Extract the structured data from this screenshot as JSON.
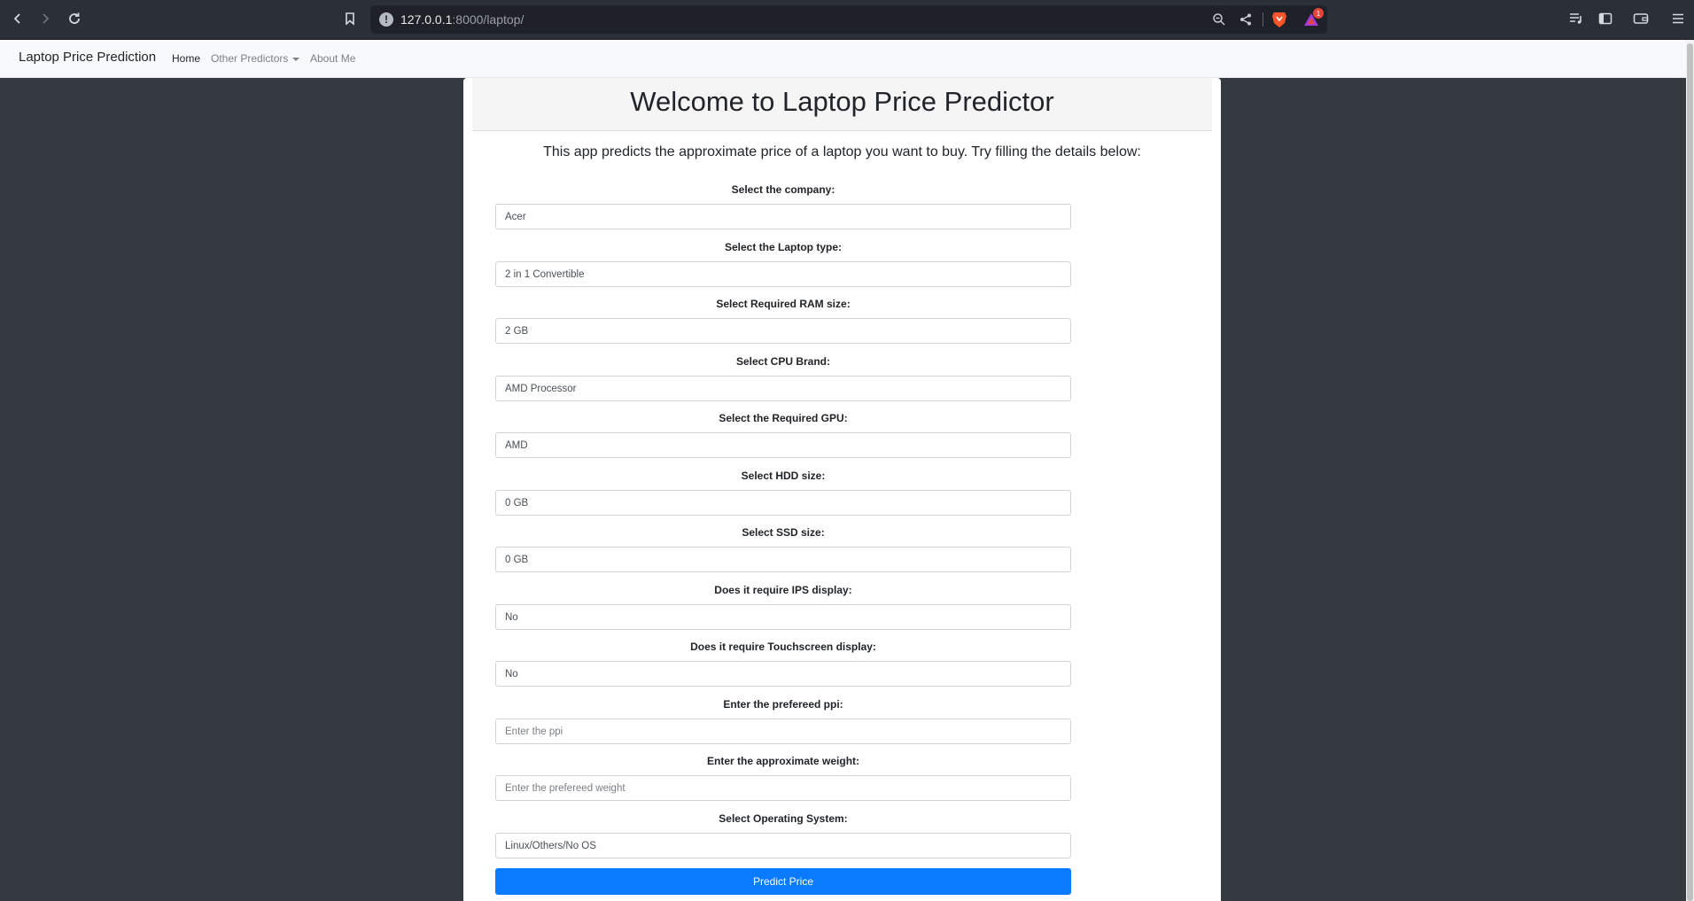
{
  "browser": {
    "url_host": "127.0.0.1",
    "url_rest": ":8000/laptop/",
    "rewards_count": "1"
  },
  "navbar": {
    "brand": "Laptop Price Prediction",
    "links": [
      {
        "label": "Home",
        "active": true
      },
      {
        "label": "Other Predictors",
        "dropdown": true
      },
      {
        "label": "About Me"
      }
    ]
  },
  "page": {
    "title": "Welcome to Laptop Price Predictor",
    "intro": "This app predicts the approximate price of a laptop you want to buy. Try filling the details below:"
  },
  "form": {
    "fields": [
      {
        "label": "Select the company:",
        "value": "Acer",
        "kind": "select"
      },
      {
        "label": "Select the Laptop type:",
        "value": "2 in 1 Convertible",
        "kind": "select"
      },
      {
        "label": "Select Required RAM size:",
        "value": "2 GB",
        "kind": "select"
      },
      {
        "label": "Select CPU Brand:",
        "value": "AMD Processor",
        "kind": "select"
      },
      {
        "label": "Select the Required GPU:",
        "value": "AMD",
        "kind": "select"
      },
      {
        "label": "Select HDD size:",
        "value": "0 GB",
        "kind": "select"
      },
      {
        "label": "Select SSD size:",
        "value": "0 GB",
        "kind": "select"
      },
      {
        "label": "Does it require IPS display:",
        "value": "No",
        "kind": "select"
      },
      {
        "label": "Does it require Touchscreen display:",
        "value": "No",
        "kind": "select"
      },
      {
        "label": "Enter the prefereed ppi:",
        "placeholder": "Enter the ppi",
        "kind": "input"
      },
      {
        "label": "Enter the approximate weight:",
        "placeholder": "Enter the prefereed weight",
        "kind": "input"
      },
      {
        "label": "Select Operating System:",
        "value": "Linux/Others/No OS",
        "kind": "select"
      }
    ],
    "submit_label": "Predict Price"
  },
  "colors": {
    "page_bg": "#343a40",
    "button_primary": "#0a7bff",
    "navbar_bg": "#f8f9fa"
  }
}
